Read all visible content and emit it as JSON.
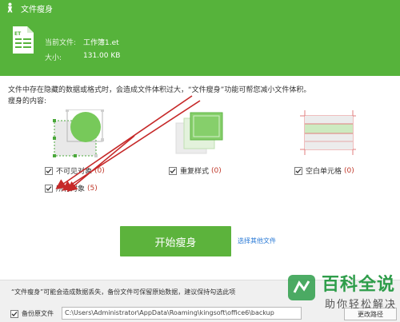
{
  "window": {
    "title": "文件瘦身"
  },
  "file_info": {
    "current_label": "当前文件:",
    "current_value": "工作簿1.et",
    "size_label": "大小:",
    "size_value": "131.00 KB",
    "file_icon_text": "ET"
  },
  "description": "文件中存在隐藏的数据或格式时，会造成文件体积过大，“文件瘦身”功能可帮您减小文件体积。",
  "content_label": "瘦身的内容:",
  "options": [
    {
      "label": "不可见对象",
      "count": "(0)",
      "checked": true
    },
    {
      "label": "重复样式",
      "count": "(0)",
      "checked": true
    },
    {
      "label": "空白单元格",
      "count": "(0)",
      "checked": true
    },
    {
      "label": "所有对象",
      "count": "(5)",
      "checked": true
    }
  ],
  "actions": {
    "start_label": "开始瘦身",
    "other_files_label": "选择其他文件"
  },
  "footer": {
    "warning": "“文件瘦身”可能会造成数据丢失，备份文件可保留原始数据，建议保持勾选此项",
    "backup_label": "备份原文件",
    "backup_checked": true,
    "path_value": "C:\\Users\\Administrator\\AppData\\Roaming\\kingsoft\\office6\\backup",
    "change_path_label": "更改路径"
  },
  "watermark": {
    "title": "百科全说",
    "subtitle": "助你轻松解决"
  },
  "colors": {
    "header": "#56b33b",
    "button": "#5cb33c",
    "count": "#c0392b",
    "link": "#2a7ad6",
    "arrow": "#c62828"
  }
}
